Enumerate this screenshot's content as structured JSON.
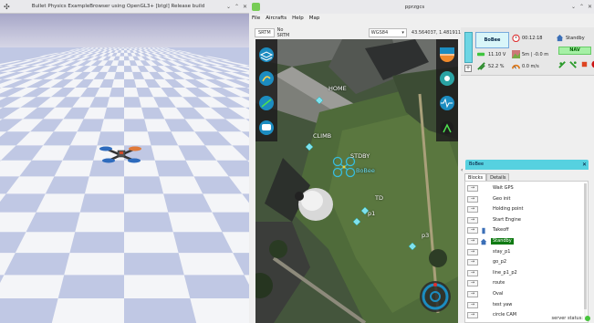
{
  "bullet": {
    "title": "Bullet Physics ExampleBrowser using OpenGL3+ [btgl] Release build",
    "controls": {
      "min": "⌄",
      "max": "⌃",
      "close": "✕"
    }
  },
  "gcs": {
    "title": "pprzgcs",
    "controls": {
      "min": "⌄",
      "max": "⌃",
      "close": "✕"
    },
    "menu": [
      "File",
      "Aircrafts",
      "Help",
      "Map"
    ],
    "maptool": {
      "srtm_button": "SRTM",
      "srtm_status": "No SRTM",
      "projection": "WGS84",
      "coords": "43.564037,  1.481911"
    },
    "map_labels": {
      "home": "HOME",
      "climb": "CLIMB",
      "stdby": "STDBY",
      "aircraft": "BoBee",
      "td": "TD",
      "p1": "p1",
      "p3": "p3"
    },
    "strip": {
      "name": "BoBee",
      "flight_time": "00:12:18",
      "mode": "Standby",
      "voltage": "11.10 V",
      "altitude": "5m | -0.0 m",
      "nav": "NAV",
      "throttle": "52.2 %",
      "speed": "0.0 m/s",
      "plus": "+"
    },
    "dock": {
      "header": "BoBee",
      "close": "✕",
      "left_arrow": "‹",
      "tabs": [
        "Blocks",
        "Details"
      ]
    },
    "blocks": [
      {
        "label": "Wait GPS",
        "icon": "",
        "current": false
      },
      {
        "label": "Geo init",
        "icon": "",
        "current": false
      },
      {
        "label": "Holding point",
        "icon": "",
        "current": false
      },
      {
        "label": "Start Engine",
        "icon": "",
        "current": false
      },
      {
        "label": "Takeoff",
        "icon": "takeoff-icon",
        "current": false
      },
      {
        "label": "Standby",
        "icon": "home-icon",
        "current": true
      },
      {
        "label": "stay_p1",
        "icon": "",
        "current": false
      },
      {
        "label": "go_p2",
        "icon": "",
        "current": false
      },
      {
        "label": "line_p1_p2",
        "icon": "",
        "current": false
      },
      {
        "label": "route",
        "icon": "",
        "current": false
      },
      {
        "label": "Oval",
        "icon": "",
        "current": false
      },
      {
        "label": "test yaw",
        "icon": "",
        "current": false
      },
      {
        "label": "circle CAM",
        "icon": "",
        "current": false
      }
    ],
    "arrow_glyph": "→",
    "status_text": "server status:",
    "colors": {
      "accent_cyan": "#56d1e0",
      "nav_green": "#a6f0a6",
      "current_block": "#0f7a12",
      "server_ok": "#46c43c"
    }
  }
}
